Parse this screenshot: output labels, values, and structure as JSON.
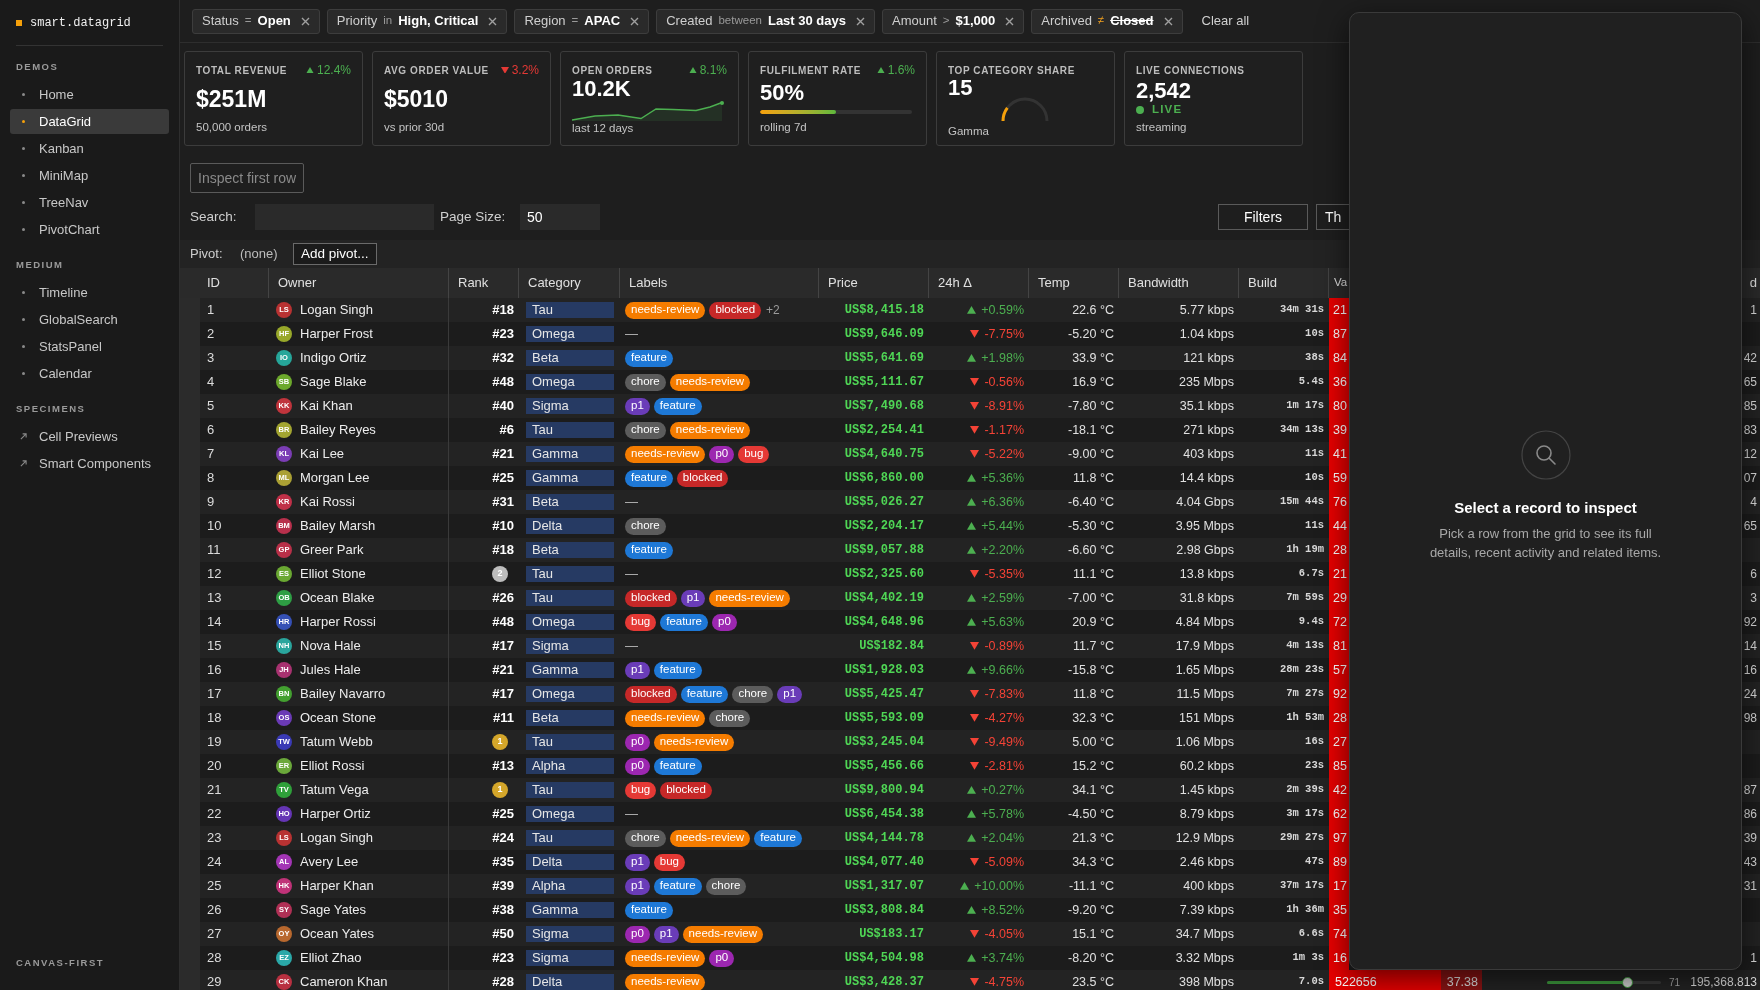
{
  "sidebar": {
    "logo": "smart.datagrid",
    "sections": [
      {
        "title": "DEMOS",
        "items": [
          {
            "label": "Home",
            "kind": "page",
            "selected": false
          },
          {
            "label": "DataGrid",
            "kind": "page",
            "selected": true
          },
          {
            "label": "Kanban",
            "kind": "page",
            "selected": false
          },
          {
            "label": "MiniMap",
            "kind": "page",
            "selected": false
          },
          {
            "label": "TreeNav",
            "kind": "page",
            "selected": false
          },
          {
            "label": "PivotChart",
            "kind": "page",
            "selected": false
          }
        ]
      },
      {
        "title": "MEDIUM",
        "items": [
          {
            "label": "Timeline",
            "kind": "page",
            "selected": false
          },
          {
            "label": "GlobalSearch",
            "kind": "page",
            "selected": false
          },
          {
            "label": "StatsPanel",
            "kind": "page",
            "selected": false
          },
          {
            "label": "Calendar",
            "kind": "page",
            "selected": false
          }
        ]
      },
      {
        "title": "SPECIMENS",
        "items": [
          {
            "label": "Cell Previews",
            "kind": "link",
            "selected": false
          },
          {
            "label": "Smart Components",
            "kind": "link",
            "selected": false
          }
        ]
      }
    ],
    "footer_title": "CANVAS-FIRST"
  },
  "filters": [
    {
      "field": "Status",
      "operator": "=",
      "value": "Open",
      "negated": false
    },
    {
      "field": "Priority",
      "operator": "in",
      "value": "High, Critical",
      "negated": false
    },
    {
      "field": "Region",
      "operator": "=",
      "value": "APAC",
      "negated": false
    },
    {
      "field": "Created",
      "operator": "between",
      "value": "Last 30 days",
      "negated": false
    },
    {
      "field": "Amount",
      "operator": ">",
      "value": "$1,000",
      "negated": false
    },
    {
      "field": "Archived",
      "operator": "≠",
      "value": "Closed",
      "negated": true
    }
  ],
  "clear_all": "Clear all",
  "kpis": [
    {
      "kind": "stat",
      "label": "TOTAL REVENUE",
      "delta": {
        "text": "12.4%",
        "up": true
      },
      "value": "$251M",
      "caption": "50,000 orders"
    },
    {
      "kind": "stat",
      "label": "AVG ORDER VALUE",
      "delta": {
        "text": "3.2%",
        "up": false
      },
      "value": "$5010",
      "caption": "vs prior 30d"
    },
    {
      "kind": "sparkline",
      "label": "OPEN ORDERS",
      "delta": {
        "text": "8.1%",
        "up": true
      },
      "value": "10.2K",
      "caption": "last 12 days"
    },
    {
      "kind": "progress",
      "label": "FULFILMENT RATE",
      "delta": {
        "text": "1.6%",
        "up": true
      },
      "value": "50%",
      "level": 0.5,
      "caption": "rolling 7d"
    },
    {
      "kind": "gauge",
      "label": "TOP CATEGORY SHARE",
      "value": "15",
      "level": 0.15,
      "caption": "Gamma"
    },
    {
      "kind": "live",
      "label": "LIVE CONNECTIONS",
      "value": "2,542",
      "status": "LIVE",
      "caption": "streaming"
    }
  ],
  "toolbar": {
    "inspect_button": {
      "label": "Inspect first row",
      "disabled": true
    },
    "search_label": "Search:",
    "page_size_label": "Page Size:",
    "page_size": "50",
    "buttons": [
      "Filters",
      "Th"
    ]
  },
  "pivot": {
    "label": "Pivot:",
    "value": "(none)",
    "button": "Add pivot..."
  },
  "table": {
    "columns": [
      "ID",
      "Owner",
      "Rank",
      "Category",
      "Labels",
      "Price",
      "24h Δ",
      "Temp",
      "Bandwidth",
      "Build",
      "Va"
    ],
    "column_13_header": "d",
    "rows": [
      {
        "id": "1",
        "owner": {
          "initials": "LS",
          "name": "Logan Singh",
          "color": "#b83232"
        },
        "rank": {
          "kind": "number",
          "text": "#18"
        },
        "category": "Tau",
        "labels": [
          {
            "text": "needs-review",
            "color": "#f57c00"
          },
          {
            "text": "blocked",
            "color": "#c62828"
          }
        ],
        "labels_more": "+2",
        "price": "US$8,415.18",
        "change": {
          "text": "+0.59%",
          "up": true
        },
        "temp": "22.6 °C",
        "bandwidth": "5.77 kbps",
        "build": "34m 31s",
        "value": "21",
        "column_13": "1"
      },
      {
        "id": "2",
        "owner": {
          "initials": "HF",
          "name": "Harper Frost",
          "color": "#98a82a"
        },
        "rank": {
          "kind": "number",
          "text": "#23"
        },
        "category": "Omega",
        "no_labels": "—",
        "price": "US$9,646.09",
        "change": {
          "text": "-7.75%",
          "up": false
        },
        "temp": "-5.20 °C",
        "bandwidth": "1.04 kbps",
        "build": "10s",
        "value": "87"
      },
      {
        "id": "3",
        "owner": {
          "initials": "IO",
          "name": "Indigo Ortiz",
          "color": "#26a69a"
        },
        "rank": {
          "kind": "number",
          "text": "#32"
        },
        "category": "Beta",
        "labels": [
          {
            "text": "feature",
            "color": "#1e78d6"
          }
        ],
        "price": "US$5,641.69",
        "change": {
          "text": "+1.98%",
          "up": true
        },
        "temp": "33.9 °C",
        "bandwidth": "121 kbps",
        "build": "38s",
        "value": "84",
        "column_13": "42"
      },
      {
        "id": "4",
        "owner": {
          "initials": "SB",
          "name": "Sage Blake",
          "color": "#6ca82c"
        },
        "rank": {
          "kind": "number",
          "text": "#48"
        },
        "category": "Omega",
        "labels": [
          {
            "text": "chore",
            "color": "#5c5c5c"
          },
          {
            "text": "needs-review",
            "color": "#f57c00"
          }
        ],
        "price": "US$5,111.67",
        "change": {
          "text": "-0.56%",
          "up": false
        },
        "temp": "16.9 °C",
        "bandwidth": "235 Mbps",
        "build": "5.4s",
        "value": "36",
        "column_13": "65"
      },
      {
        "id": "5",
        "owner": {
          "initials": "KK",
          "name": "Kai Khan",
          "color": "#c0343c"
        },
        "rank": {
          "kind": "number",
          "text": "#40"
        },
        "category": "Sigma",
        "labels": [
          {
            "text": "p1",
            "color": "#6a3cb8"
          },
          {
            "text": "feature",
            "color": "#1e78d6"
          }
        ],
        "price": "US$7,490.68",
        "change": {
          "text": "-8.91%",
          "up": false
        },
        "temp": "-7.80 °C",
        "bandwidth": "35.1 kbps",
        "build": "1m 17s",
        "value": "80",
        "column_13": "85"
      },
      {
        "id": "6",
        "owner": {
          "initials": "BR",
          "name": "Bailey Reyes",
          "color": "#a3a531"
        },
        "rank": {
          "kind": "number",
          "text": "#6"
        },
        "category": "Tau",
        "labels": [
          {
            "text": "chore",
            "color": "#5c5c5c"
          },
          {
            "text": "needs-review",
            "color": "#f57c00"
          }
        ],
        "price": "US$2,254.41",
        "change": {
          "text": "-1.17%",
          "up": false
        },
        "temp": "-18.1 °C",
        "bandwidth": "271 kbps",
        "build": "34m 13s",
        "value": "39",
        "column_13": "83"
      },
      {
        "id": "7",
        "owner": {
          "initials": "KL",
          "name": "Kai Lee",
          "color": "#7b3db5"
        },
        "rank": {
          "kind": "number",
          "text": "#21"
        },
        "category": "Gamma",
        "labels": [
          {
            "text": "needs-review",
            "color": "#f57c00"
          },
          {
            "text": "p0",
            "color": "#9c27b0"
          },
          {
            "text": "bug",
            "color": "#e53935"
          }
        ],
        "price": "US$4,640.75",
        "change": {
          "text": "-5.22%",
          "up": false
        },
        "temp": "-9.00 °C",
        "bandwidth": "403 kbps",
        "build": "11s",
        "value": "41",
        "column_13": "12"
      },
      {
        "id": "8",
        "owner": {
          "initials": "ML",
          "name": "Morgan Lee",
          "color": "#aaa034"
        },
        "rank": {
          "kind": "number",
          "text": "#25"
        },
        "category": "Gamma",
        "labels": [
          {
            "text": "feature",
            "color": "#1e78d6"
          },
          {
            "text": "blocked",
            "color": "#c62828"
          }
        ],
        "price": "US$6,860.00",
        "change": {
          "text": "+5.36%",
          "up": true
        },
        "temp": "11.8 °C",
        "bandwidth": "14.4 kbps",
        "build": "10s",
        "value": "59",
        "column_13": "07"
      },
      {
        "id": "9",
        "owner": {
          "initials": "KR",
          "name": "Kai Rossi",
          "color": "#c03048"
        },
        "rank": {
          "kind": "number",
          "text": "#31"
        },
        "category": "Beta",
        "no_labels": "—",
        "price": "US$5,026.27",
        "change": {
          "text": "+6.36%",
          "up": true
        },
        "temp": "-6.40 °C",
        "bandwidth": "4.04 Gbps",
        "build": "15m 44s",
        "value": "76",
        "column_13": "4"
      },
      {
        "id": "10",
        "owner": {
          "initials": "BM",
          "name": "Bailey Marsh",
          "color": "#b8304c"
        },
        "rank": {
          "kind": "number",
          "text": "#10"
        },
        "category": "Delta",
        "labels": [
          {
            "text": "chore",
            "color": "#5c5c5c"
          }
        ],
        "price": "US$2,204.17",
        "change": {
          "text": "+5.44%",
          "up": true
        },
        "temp": "-5.30 °C",
        "bandwidth": "3.95 Mbps",
        "build": "11s",
        "value": "44",
        "column_13": "65"
      },
      {
        "id": "11",
        "owner": {
          "initials": "GP",
          "name": "Greer Park",
          "color": "#b83048"
        },
        "rank": {
          "kind": "number",
          "text": "#18"
        },
        "category": "Beta",
        "labels": [
          {
            "text": "feature",
            "color": "#1e78d6"
          }
        ],
        "price": "US$9,057.88",
        "change": {
          "text": "+2.20%",
          "up": true
        },
        "temp": "-6.60 °C",
        "bandwidth": "2.98 Gbps",
        "build": "1h 19m",
        "value": "28"
      },
      {
        "id": "12",
        "owner": {
          "initials": "ES",
          "name": "Elliot Stone",
          "color": "#6aa832"
        },
        "rank": {
          "kind": "medal",
          "text": "2",
          "color": "#bdbdbd"
        },
        "category": "Tau",
        "no_labels": "—",
        "price": "US$2,325.60",
        "change": {
          "text": "-5.35%",
          "up": false
        },
        "temp": "11.1 °C",
        "bandwidth": "13.8 kbps",
        "build": "6.7s",
        "value": "21",
        "column_13": "6"
      },
      {
        "id": "13",
        "owner": {
          "initials": "OB",
          "name": "Ocean Blake",
          "color": "#2e9e44"
        },
        "rank": {
          "kind": "number",
          "text": "#26"
        },
        "category": "Tau",
        "labels": [
          {
            "text": "blocked",
            "color": "#c62828"
          },
          {
            "text": "p1",
            "color": "#6a3cb8"
          },
          {
            "text": "needs-review",
            "color": "#f57c00"
          }
        ],
        "price": "US$4,402.19",
        "change": {
          "text": "+2.59%",
          "up": true
        },
        "temp": "-7.00 °C",
        "bandwidth": "31.8 kbps",
        "build": "7m 59s",
        "value": "29",
        "column_13": "3"
      },
      {
        "id": "14",
        "owner": {
          "initials": "HR",
          "name": "Harper Rossi",
          "color": "#3550b5"
        },
        "rank": {
          "kind": "number",
          "text": "#48"
        },
        "category": "Omega",
        "labels": [
          {
            "text": "bug",
            "color": "#e53935"
          },
          {
            "text": "feature",
            "color": "#1e78d6"
          },
          {
            "text": "p0",
            "color": "#9c27b0"
          }
        ],
        "price": "US$4,648.96",
        "change": {
          "text": "+5.63%",
          "up": true
        },
        "temp": "20.9 °C",
        "bandwidth": "4.84 Mbps",
        "build": "9.4s",
        "value": "72",
        "column_13": "92"
      },
      {
        "id": "15",
        "owner": {
          "initials": "NH",
          "name": "Nova Hale",
          "color": "#2aa59d"
        },
        "rank": {
          "kind": "number",
          "text": "#17"
        },
        "category": "Sigma",
        "no_labels": "—",
        "price": "US$182.84",
        "change": {
          "text": "-0.89%",
          "up": false
        },
        "temp": "11.7 °C",
        "bandwidth": "17.9 Mbps",
        "build": "4m 13s",
        "value": "81",
        "column_13": "14"
      },
      {
        "id": "16",
        "owner": {
          "initials": "JH",
          "name": "Jules Hale",
          "color": "#a83270"
        },
        "rank": {
          "kind": "number",
          "text": "#21"
        },
        "category": "Gamma",
        "labels": [
          {
            "text": "p1",
            "color": "#6a3cb8"
          },
          {
            "text": "feature",
            "color": "#1e78d6"
          }
        ],
        "price": "US$1,928.03",
        "change": {
          "text": "+9.66%",
          "up": true
        },
        "temp": "-15.8 °C",
        "bandwidth": "1.65 Mbps",
        "build": "28m 23s",
        "value": "57",
        "column_13": "16"
      },
      {
        "id": "17",
        "owner": {
          "initials": "BN",
          "name": "Bailey Navarro",
          "color": "#43a030"
        },
        "rank": {
          "kind": "number",
          "text": "#17"
        },
        "category": "Omega",
        "labels": [
          {
            "text": "blocked",
            "color": "#c62828"
          },
          {
            "text": "feature",
            "color": "#1e78d6"
          },
          {
            "text": "chore",
            "color": "#5c5c5c"
          },
          {
            "text": "p1",
            "color": "#6a3cb8"
          }
        ],
        "price": "US$5,425.47",
        "change": {
          "text": "-7.83%",
          "up": false
        },
        "temp": "11.8 °C",
        "bandwidth": "11.5 Mbps",
        "build": "7m 27s",
        "value": "92",
        "column_13": "24"
      },
      {
        "id": "18",
        "owner": {
          "initials": "OS",
          "name": "Ocean Stone",
          "color": "#6a3ab5"
        },
        "rank": {
          "kind": "number",
          "text": "#11"
        },
        "category": "Beta",
        "labels": [
          {
            "text": "needs-review",
            "color": "#f57c00"
          },
          {
            "text": "chore",
            "color": "#5c5c5c"
          }
        ],
        "price": "US$5,593.09",
        "change": {
          "text": "-4.27%",
          "up": false
        },
        "temp": "32.3 °C",
        "bandwidth": "151 Mbps",
        "build": "1h 53m",
        "value": "28",
        "column_13": "98"
      },
      {
        "id": "19",
        "owner": {
          "initials": "TW",
          "name": "Tatum Webb",
          "color": "#3a3ab5"
        },
        "rank": {
          "kind": "medal",
          "text": "1",
          "color": "#d4a62a"
        },
        "category": "Tau",
        "labels": [
          {
            "text": "p0",
            "color": "#9c27b0"
          },
          {
            "text": "needs-review",
            "color": "#f57c00"
          }
        ],
        "price": "US$3,245.04",
        "change": {
          "text": "-9.49%",
          "up": false
        },
        "temp": "5.00 °C",
        "bandwidth": "1.06 Mbps",
        "build": "16s",
        "value": "27"
      },
      {
        "id": "20",
        "owner": {
          "initials": "ER",
          "name": "Elliot Rossi",
          "color": "#6aa83a"
        },
        "rank": {
          "kind": "number",
          "text": "#13"
        },
        "category": "Alpha",
        "labels": [
          {
            "text": "p0",
            "color": "#9c27b0"
          },
          {
            "text": "feature",
            "color": "#1e78d6"
          }
        ],
        "price": "US$5,456.66",
        "change": {
          "text": "-2.81%",
          "up": false
        },
        "temp": "15.2 °C",
        "bandwidth": "60.2 kbps",
        "build": "23s",
        "value": "85"
      },
      {
        "id": "21",
        "owner": {
          "initials": "TV",
          "name": "Tatum Vega",
          "color": "#2fa03a"
        },
        "rank": {
          "kind": "medal",
          "text": "1",
          "color": "#d4a62a"
        },
        "category": "Tau",
        "labels": [
          {
            "text": "bug",
            "color": "#e53935"
          },
          {
            "text": "blocked",
            "color": "#c62828"
          }
        ],
        "price": "US$9,800.94",
        "change": {
          "text": "+0.27%",
          "up": true
        },
        "temp": "34.1 °C",
        "bandwidth": "1.45 kbps",
        "build": "2m 39s",
        "value": "42",
        "column_13": "87"
      },
      {
        "id": "22",
        "owner": {
          "initials": "HO",
          "name": "Harper Ortiz",
          "color": "#6535b5"
        },
        "rank": {
          "kind": "number",
          "text": "#25"
        },
        "category": "Omega",
        "no_labels": "—",
        "price": "US$6,454.38",
        "change": {
          "text": "+5.78%",
          "up": true
        },
        "temp": "-4.50 °C",
        "bandwidth": "8.79 kbps",
        "build": "3m 17s",
        "value": "62",
        "column_13": "86"
      },
      {
        "id": "23",
        "owner": {
          "initials": "LS",
          "name": "Logan Singh",
          "color": "#b83232"
        },
        "rank": {
          "kind": "number",
          "text": "#24"
        },
        "category": "Tau",
        "labels": [
          {
            "text": "chore",
            "color": "#5c5c5c"
          },
          {
            "text": "needs-review",
            "color": "#f57c00"
          },
          {
            "text": "feature",
            "color": "#1e78d6"
          }
        ],
        "price": "US$4,144.78",
        "change": {
          "text": "+2.04%",
          "up": true
        },
        "temp": "21.3 °C",
        "bandwidth": "12.9 Mbps",
        "build": "29m 27s",
        "value": "97",
        "column_13": "39"
      },
      {
        "id": "24",
        "owner": {
          "initials": "AL",
          "name": "Avery Lee",
          "color": "#a335b5"
        },
        "rank": {
          "kind": "number",
          "text": "#35"
        },
        "category": "Delta",
        "labels": [
          {
            "text": "p1",
            "color": "#6a3cb8"
          },
          {
            "text": "bug",
            "color": "#e53935"
          }
        ],
        "price": "US$4,077.40",
        "change": {
          "text": "-5.09%",
          "up": false
        },
        "temp": "34.3 °C",
        "bandwidth": "2.46 kbps",
        "build": "47s",
        "value": "89",
        "column_13": "43"
      },
      {
        "id": "25",
        "owner": {
          "initials": "HK",
          "name": "Harper Khan",
          "color": "#c03278"
        },
        "rank": {
          "kind": "number",
          "text": "#39"
        },
        "category": "Alpha",
        "labels": [
          {
            "text": "p1",
            "color": "#6a3cb8"
          },
          {
            "text": "feature",
            "color": "#1e78d6"
          },
          {
            "text": "chore",
            "color": "#5c5c5c"
          }
        ],
        "price": "US$1,317.07",
        "change": {
          "text": "+10.00%",
          "up": true
        },
        "temp": "-11.1 °C",
        "bandwidth": "400 kbps",
        "build": "37m 17s",
        "value": "17",
        "column_13": "31"
      },
      {
        "id": "26",
        "owner": {
          "initials": "SY",
          "name": "Sage Yates",
          "color": "#b03055"
        },
        "rank": {
          "kind": "number",
          "text": "#38"
        },
        "category": "Gamma",
        "labels": [
          {
            "text": "feature",
            "color": "#1e78d6"
          }
        ],
        "price": "US$3,808.84",
        "change": {
          "text": "+8.52%",
          "up": true
        },
        "temp": "-9.20 °C",
        "bandwidth": "7.39 kbps",
        "build": "1h 36m",
        "value": "35"
      },
      {
        "id": "27",
        "owner": {
          "initials": "OY",
          "name": "Ocean Yates",
          "color": "#b8682e"
        },
        "rank": {
          "kind": "number",
          "text": "#50"
        },
        "category": "Sigma",
        "labels": [
          {
            "text": "p0",
            "color": "#9c27b0"
          },
          {
            "text": "p1",
            "color": "#6a3cb8"
          },
          {
            "text": "needs-review",
            "color": "#f57c00"
          }
        ],
        "price": "US$183.17",
        "change": {
          "text": "-4.05%",
          "up": false
        },
        "temp": "15.1 °C",
        "bandwidth": "34.7 Mbps",
        "build": "6.6s",
        "value": "74"
      },
      {
        "id": "28",
        "owner": {
          "initials": "EZ",
          "name": "Elliot Zhao",
          "color": "#2aa8a8"
        },
        "rank": {
          "kind": "number",
          "text": "#23"
        },
        "category": "Sigma",
        "labels": [
          {
            "text": "needs-review",
            "color": "#f57c00"
          },
          {
            "text": "p0",
            "color": "#9c27b0"
          }
        ],
        "price": "US$4,504.98",
        "change": {
          "text": "+3.74%",
          "up": true
        },
        "temp": "-8.20 °C",
        "bandwidth": "3.32 Mbps",
        "build": "1m 3s",
        "value": "16",
        "column_13": "1"
      },
      {
        "id": "29",
        "owner": {
          "initials": "CK",
          "name": "Cameron Khan",
          "color": "#b83040"
        },
        "rank": {
          "kind": "number",
          "text": "#28"
        },
        "category": "Delta",
        "labels": [
          {
            "text": "needs-review",
            "color": "#f57c00"
          }
        ],
        "price": "US$3,428.37",
        "change": {
          "text": "-4.75%",
          "up": false
        },
        "temp": "23.5 °C",
        "bandwidth": "398 Mbps",
        "build": "7.0s",
        "value": "522656",
        "column_11": "37.38",
        "column_12": {
          "level": 0.71,
          "reading": "71"
        },
        "column_13": "195,368.813"
      }
    ]
  },
  "inspector": {
    "title": "Select a record to inspect",
    "description": "Pick a row from the grid to see its full details, recent activity and related items."
  }
}
